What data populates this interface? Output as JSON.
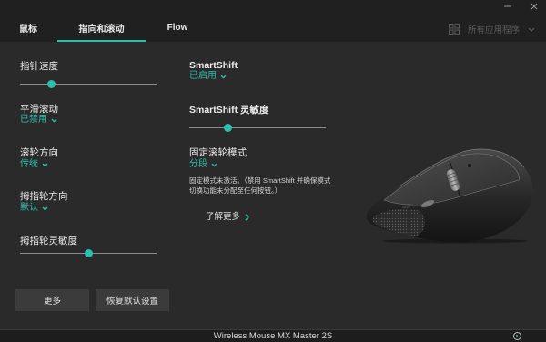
{
  "window": {
    "minimize_icon": "minimize-icon",
    "close_icon": "close-icon"
  },
  "tabs": [
    {
      "label": "鼠标",
      "active": false
    },
    {
      "label": "指向和滚动",
      "active": true
    },
    {
      "label": "Flow",
      "active": false
    }
  ],
  "app_selector": {
    "icon": "grid-icon",
    "label": "所有应用程序"
  },
  "left_settings": {
    "pointer_speed": {
      "label": "指针速度",
      "value": 0.23
    },
    "smooth_scrolling": {
      "label": "平滑滚动",
      "value": "已禁用"
    },
    "scroll_direction": {
      "label": "滚轮方向",
      "value": "传统"
    },
    "thumbwheel_direction": {
      "label": "拇指轮方向",
      "value": "默认"
    },
    "thumbwheel_sensitivity": {
      "label": "拇指轮灵敏度",
      "value": 0.5
    }
  },
  "right_settings": {
    "smartshift": {
      "label": "SmartShift",
      "value": "已启用"
    },
    "smartshift_sensitivity": {
      "label": "SmartShift 灵敏度",
      "value": 0.28
    },
    "fixed_scroll_mode": {
      "label": "固定滚轮模式",
      "value": "分段",
      "note": "固定模式未激活。（禁用 SmartShift 并确保模式切换功能未分配至任何按钮。）"
    },
    "learn_more": "了解更多"
  },
  "buttons": {
    "more": "更多",
    "restore_defaults": "恢复默认设置"
  },
  "footer": {
    "device_name": "Wireless Mouse MX Master 2S",
    "status_icon": "battery-icon"
  },
  "colors": {
    "accent": "#2bbfb0",
    "background": "#2a2a2a",
    "header_background": "#202020",
    "text": "#e8e8e8",
    "muted": "#5c5c5c"
  }
}
